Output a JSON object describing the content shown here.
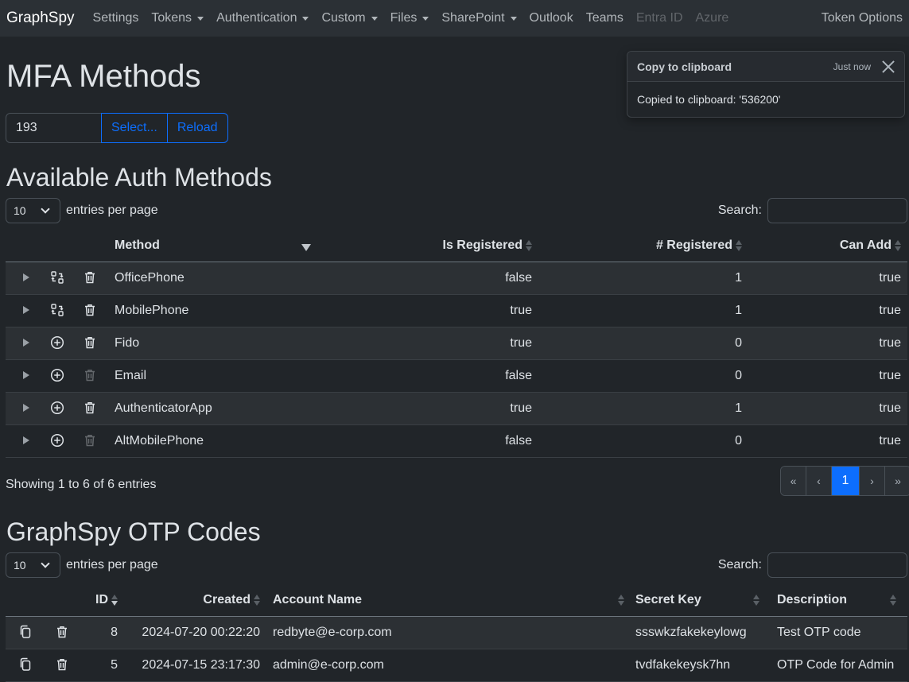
{
  "nav": {
    "brand": "GraphSpy",
    "items": [
      {
        "label": "Settings",
        "dropdown": false,
        "disabled": false
      },
      {
        "label": "Tokens",
        "dropdown": true,
        "disabled": false
      },
      {
        "label": "Authentication",
        "dropdown": true,
        "disabled": false
      },
      {
        "label": "Custom",
        "dropdown": true,
        "disabled": false
      },
      {
        "label": "Files",
        "dropdown": true,
        "disabled": false
      },
      {
        "label": "SharePoint",
        "dropdown": true,
        "disabled": false
      },
      {
        "label": "Outlook",
        "dropdown": false,
        "disabled": false
      },
      {
        "label": "Teams",
        "dropdown": false,
        "disabled": false
      },
      {
        "label": "Entra ID",
        "dropdown": false,
        "disabled": true
      },
      {
        "label": "Azure",
        "dropdown": false,
        "disabled": true
      }
    ],
    "right": "Token Options"
  },
  "page_title": "MFA Methods",
  "token_group": {
    "value": "193",
    "select_label": "Select...",
    "reload_label": "Reload"
  },
  "toast": {
    "title": "Copy to clipboard",
    "time": "Just now",
    "message": "Copied to clipboard: '536200'"
  },
  "auth_section": {
    "title": "Available Auth Methods",
    "length_value": "10",
    "length_label": "entries per page",
    "search_label": "Search:",
    "columns": {
      "method": "Method",
      "is_registered": "Is Registered",
      "num_registered": "# Registered",
      "can_add": "Can Add"
    },
    "rows": [
      {
        "action_icon": "swap-icon",
        "delete_enabled": true,
        "method": "OfficePhone",
        "is_registered": "false",
        "num_registered": "1",
        "can_add": "true"
      },
      {
        "action_icon": "swap-icon",
        "delete_enabled": true,
        "method": "MobilePhone",
        "is_registered": "true",
        "num_registered": "1",
        "can_add": "true"
      },
      {
        "action_icon": "plus-circle-icon",
        "delete_enabled": true,
        "method": "Fido",
        "is_registered": "true",
        "num_registered": "0",
        "can_add": "true"
      },
      {
        "action_icon": "plus-circle-icon",
        "delete_enabled": false,
        "method": "Email",
        "is_registered": "false",
        "num_registered": "0",
        "can_add": "true"
      },
      {
        "action_icon": "plus-circle-icon",
        "delete_enabled": true,
        "method": "AuthenticatorApp",
        "is_registered": "true",
        "num_registered": "1",
        "can_add": "true"
      },
      {
        "action_icon": "plus-circle-icon",
        "delete_enabled": false,
        "method": "AltMobilePhone",
        "is_registered": "false",
        "num_registered": "0",
        "can_add": "true"
      }
    ],
    "info": "Showing 1 to 6 of 6 entries",
    "pager": {
      "first": "«",
      "prev": "‹",
      "current": "1",
      "next": "›",
      "last": "»"
    }
  },
  "otp_section": {
    "title": "GraphSpy OTP Codes",
    "length_value": "10",
    "length_label": "entries per page",
    "search_label": "Search:",
    "columns": {
      "id": "ID",
      "created": "Created",
      "account": "Account Name",
      "secret": "Secret Key",
      "description": "Description"
    },
    "rows": [
      {
        "id": "8",
        "created": "2024-07-20 00:22:20",
        "account": "redbyte@e-corp.com",
        "secret": "ssswkzfakekeylowg",
        "description": "Test OTP code"
      },
      {
        "id": "5",
        "created": "2024-07-15 23:17:30",
        "account": "admin@e-corp.com",
        "secret": "tvdfakekeysk7hn",
        "description": "OTP Code for Admin"
      }
    ]
  },
  "colors": {
    "background": "#212529",
    "navbar": "#2b3035",
    "primary": "#0d6efd"
  }
}
